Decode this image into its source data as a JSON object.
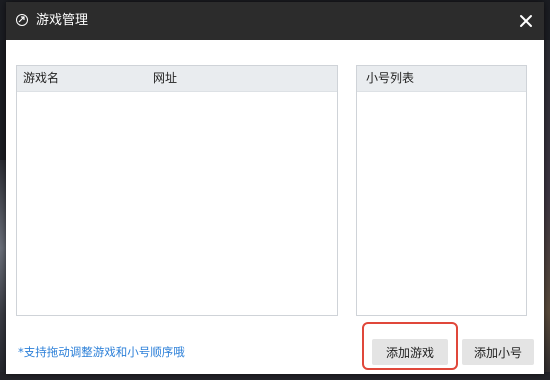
{
  "dialog": {
    "title": "游戏管理",
    "icons": {
      "app": "speed-icon",
      "close": "close-icon"
    }
  },
  "games_table": {
    "columns": [
      "游戏名",
      "网址"
    ],
    "rows": []
  },
  "accounts_list": {
    "header": "小号列表",
    "items": []
  },
  "hint_text": "*支持拖动调整游戏和小号顺序哦",
  "buttons": {
    "add_game": "添加游戏",
    "add_account": "添加小号"
  },
  "colors": {
    "titlebar": "#2c2c2c",
    "header_bg": "#e9ecef",
    "hint": "#2b7fd8",
    "highlight": "#e0473a"
  }
}
